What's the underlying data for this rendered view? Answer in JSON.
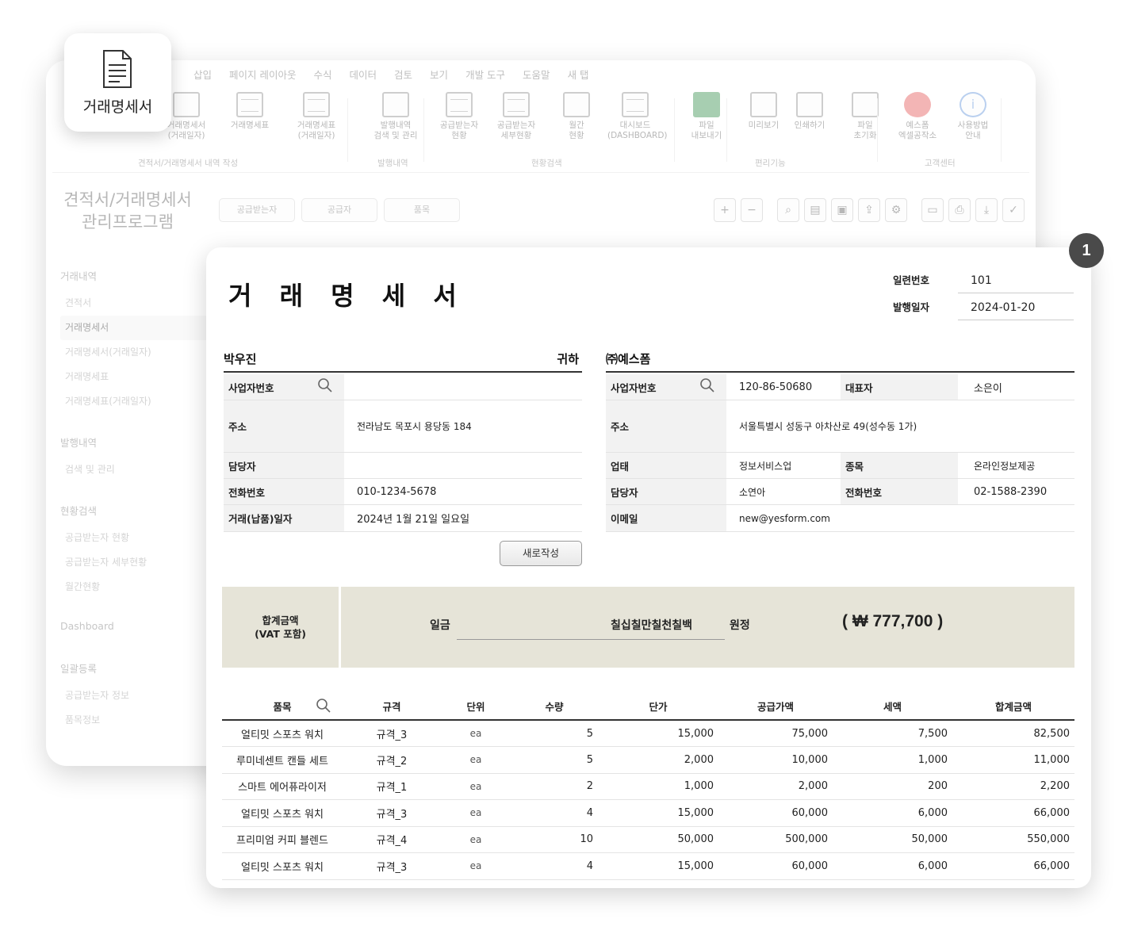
{
  "app": {
    "menu": [
      "삽입",
      "페이지 레이아웃",
      "수식",
      "데이터",
      "검토",
      "보기",
      "개발 도구",
      "도움말",
      "새 탭"
    ],
    "ribbon": [
      {
        "label": "거래명세서\n(거래일자)"
      },
      {
        "label": "거래명세표"
      },
      {
        "label": "거래명세표\n(거래일자)"
      },
      {
        "label": "발행내역\n검색 및 관리"
      },
      {
        "label": "공급받는자\n현황"
      },
      {
        "label": "공급받는자\n세부현황"
      },
      {
        "label": "월간\n현황"
      },
      {
        "label": "대시보드\n(DASHBOARD)"
      },
      {
        "label": "파일\n내보내기"
      },
      {
        "label": "미리보기"
      },
      {
        "label": "인쇄하기"
      },
      {
        "label": "파일\n초기화"
      },
      {
        "label": "예스폼\n엑셀공작소"
      },
      {
        "label": "사용방법\n안내"
      }
    ],
    "ribbon_groups": [
      "견적서/거래명세서 내역 작성",
      "발행내역",
      "현황검색",
      "편리기능",
      "고객센터"
    ],
    "sidebar_title": "견적서/거래명세서\n관리프로그램",
    "sidebar": {
      "group1": "거래내역",
      "items1": [
        "견적서",
        "거래명세서",
        "거래명세서(거래일자)",
        "거래명세표",
        "거래명세표(거래일자)"
      ],
      "group2": "발행내역",
      "items2": [
        "검색 및 관리"
      ],
      "group3": "현황검색",
      "items3": [
        "공급받는자 현황",
        "공급받는자 세부현황",
        "월간현황"
      ],
      "group4": "Dashboard",
      "group5": "일괄등록",
      "items5": [
        "공급받는자 정보",
        "품목정보"
      ]
    },
    "tabs": [
      "공급받는자",
      "공급자",
      "품목"
    ]
  },
  "card": {
    "icon": "document-icon",
    "label": "거래명세서"
  },
  "badge": "1",
  "invoice": {
    "title": "거 래 명 세 서",
    "serial_label": "일련번호",
    "serial": "101",
    "issue_label": "발행일자",
    "issue_date": "2024-01-20",
    "recipient": {
      "name": "박우진",
      "honorific": "귀하",
      "biz_no_label": "사업자번호",
      "biz_no": "",
      "address_label": "주소",
      "address": "전라남도 목포시 용당동 184",
      "manager_label": "담당자",
      "manager": "",
      "phone_label": "전화번호",
      "phone": "010-1234-5678",
      "date_label": "거래(납품)일자",
      "date": "2024년 1월 21일 일요일"
    },
    "supplier": {
      "name": "㈜예스폼",
      "biz_no_label": "사업자번호",
      "biz_no": "120-86-50680",
      "ceo_label": "대표자",
      "ceo": "소은이",
      "address_label": "주소",
      "address": "서울특별시 성동구 아차산로 49(성수동 1가)",
      "type_label": "업태",
      "type": "정보서비스업",
      "item_label": "종목",
      "item": "온라인정보제공",
      "manager_label": "담당자",
      "manager": "소연아",
      "phone_label": "전화번호",
      "phone": "02-1588-2390",
      "email_label": "이메일",
      "email": "new@yesform.com"
    },
    "new_button": "새로작성",
    "total": {
      "label": "합계금액\n(VAT 포함)",
      "il": "일금",
      "words": "칠십칠만칠천칠백",
      "won": "원정",
      "amount": "( ₩ 777,700 )"
    },
    "columns": [
      "품목",
      "규격",
      "단위",
      "수량",
      "단가",
      "공급가액",
      "세액",
      "합계금액"
    ],
    "rows": [
      [
        "얼티밋 스포츠 워치",
        "규격_3",
        "ea",
        "5",
        "15,000",
        "75,000",
        "7,500",
        "82,500"
      ],
      [
        "루미네센트 캔들 세트",
        "규격_2",
        "ea",
        "5",
        "2,000",
        "10,000",
        "1,000",
        "11,000"
      ],
      [
        "스마트 에어퓨라이저",
        "규격_1",
        "ea",
        "2",
        "1,000",
        "2,000",
        "200",
        "2,200"
      ],
      [
        "얼티밋 스포츠 워치",
        "규격_3",
        "ea",
        "4",
        "15,000",
        "60,000",
        "6,000",
        "66,000"
      ],
      [
        "프리미엄 커피 블렌드",
        "규격_4",
        "ea",
        "10",
        "50,000",
        "500,000",
        "50,000",
        "550,000"
      ],
      [
        "얼티밋 스포츠 워치",
        "규격_3",
        "ea",
        "4",
        "15,000",
        "60,000",
        "6,000",
        "66,000"
      ]
    ]
  }
}
